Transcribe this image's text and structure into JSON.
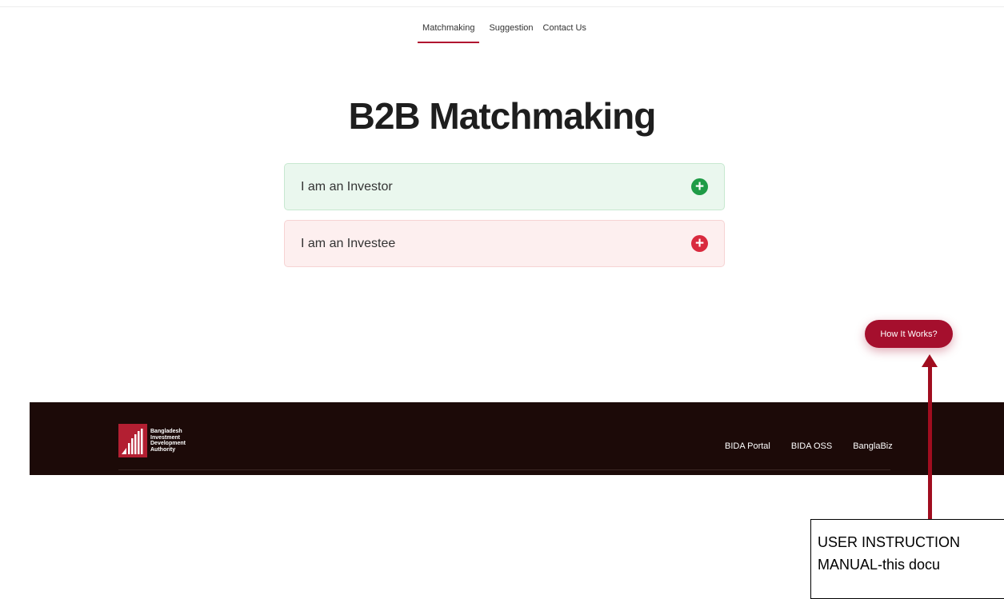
{
  "nav": {
    "items": [
      {
        "label": "Matchmaking",
        "active": true
      },
      {
        "label": "Suggestion",
        "active": false
      },
      {
        "label": "Contact Us",
        "active": false
      }
    ]
  },
  "page": {
    "title": "B2B Matchmaking"
  },
  "options": {
    "investor": {
      "label": "I am an Investor",
      "icon": "plus-circle-icon",
      "color": "#1e9b46"
    },
    "investee": {
      "label": "I am an Investee",
      "icon": "plus-circle-icon",
      "color": "#d92a3e"
    }
  },
  "help_button": {
    "label": "How It Works?",
    "color": "#a50f2d"
  },
  "footer": {
    "logo": {
      "line1": "Bangladesh",
      "line2": "Investment",
      "line3": "Development",
      "line4": "Authority"
    },
    "links": [
      "BIDA Portal",
      "BIDA OSS",
      "BanglaBiz"
    ],
    "background": "#1c0a08"
  },
  "annotation": {
    "line1": "USER INSTRUCTION",
    "line2": "MANUAL-this docu"
  }
}
